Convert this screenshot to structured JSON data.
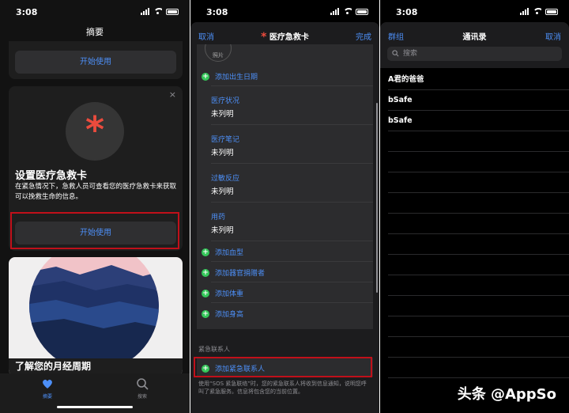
{
  "status_time": "3:08",
  "panel1": {
    "title": "摘要",
    "top_button": "开始使用",
    "card_title": "设置医疗急救卡",
    "card_desc": "在紧急情况下，急救人员可查看您的医疗急救卡来获取可以挽救生命的信息。",
    "card_button": "开始使用",
    "close": "×",
    "asterisk": "*",
    "cycle_title": "了解您的月经周期",
    "tabs": [
      {
        "label": "摘要",
        "icon": "heart-icon",
        "active": true
      },
      {
        "label": "搜索",
        "icon": "search-icon",
        "active": false
      }
    ]
  },
  "panel2": {
    "cancel": "取消",
    "title": "医疗急救卡",
    "done": "完成",
    "photo": "照片",
    "add_birthday": "添加出生日期",
    "fields": [
      {
        "key": "医疗状况",
        "value": "未列明"
      },
      {
        "key": "医疗笔记",
        "value": "未列明"
      },
      {
        "key": "过敏反应",
        "value": "未列明"
      },
      {
        "key": "用药",
        "value": "未列明"
      }
    ],
    "adds": [
      "添加血型",
      "添加器官捐赠者",
      "添加体重",
      "添加身高"
    ],
    "emergency_section": "紧急联系人",
    "add_contact": "添加紧急联系人",
    "footer": "使用“SOS 紧急联络”时，您的紧急联系人将收到信息通知，说明您呼叫了紧急服务。信息将包含您的当前位置。"
  },
  "panel3": {
    "groups": "群组",
    "title": "通讯录",
    "cancel": "取消",
    "search_placeholder": "搜索",
    "contacts": [
      "A君的爸爸",
      "bSafe",
      "bSafe"
    ]
  },
  "watermark": "头条 @AppSo",
  "colors": {
    "accent": "#4d8ff7",
    "red": "#eb4b3d",
    "green": "#34c759",
    "highlight": "#c0101a"
  }
}
